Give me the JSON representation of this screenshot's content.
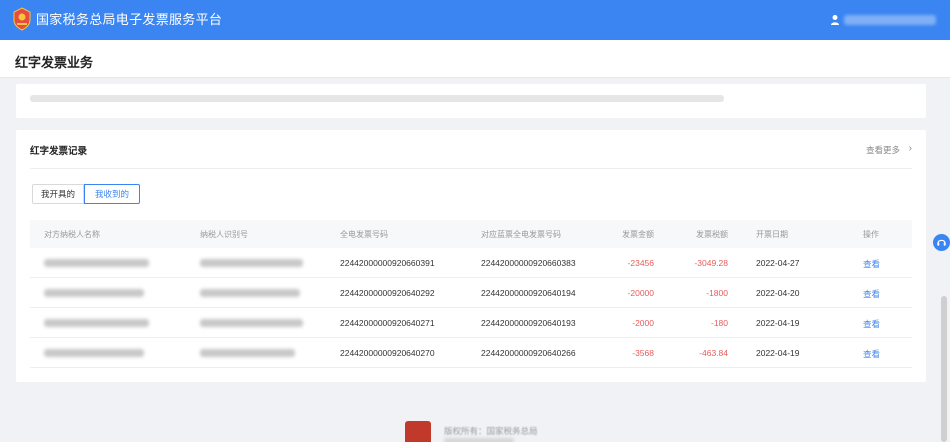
{
  "app": {
    "title": "国家税务总局电子发票服务平台"
  },
  "page": {
    "title": "红字发票业务"
  },
  "records": {
    "section_title": "红字发票记录",
    "more_label": "查看更多",
    "more_icon": "chevron-right-icon",
    "tabs": [
      {
        "label": "我开具的",
        "active": false
      },
      {
        "label": "我收到的",
        "active": true
      }
    ],
    "columns": [
      "对方纳税人名称",
      "纳税人识别号",
      "全电发票号码",
      "对应蓝票全电发票号码",
      "发票金额",
      "发票税额",
      "开票日期",
      "操作"
    ],
    "rows": [
      {
        "invoice_no": "22442000000920660391",
        "blue_invoice_no": "22442000000920660383",
        "amount": "-23456",
        "tax": "-3049.28",
        "date": "2022-04-27",
        "action": "查看"
      },
      {
        "invoice_no": "22442000000920640292",
        "blue_invoice_no": "22442000000920640194",
        "amount": "-20000",
        "tax": "-1800",
        "date": "2022-04-20",
        "action": "查看"
      },
      {
        "invoice_no": "22442000000920640271",
        "blue_invoice_no": "22442000000920640193",
        "amount": "-2000",
        "tax": "-180",
        "date": "2022-04-19",
        "action": "查看"
      },
      {
        "invoice_no": "22442000000920640270",
        "blue_invoice_no": "22442000000920640266",
        "amount": "-3568",
        "tax": "-463.84",
        "date": "2022-04-19",
        "action": "查看"
      }
    ]
  },
  "footer": {
    "copyright": "版权所有：国家税务总局"
  },
  "colors": {
    "primary": "#3a85f2",
    "negative": "#e85b5b",
    "emblem": "#c0392b"
  }
}
